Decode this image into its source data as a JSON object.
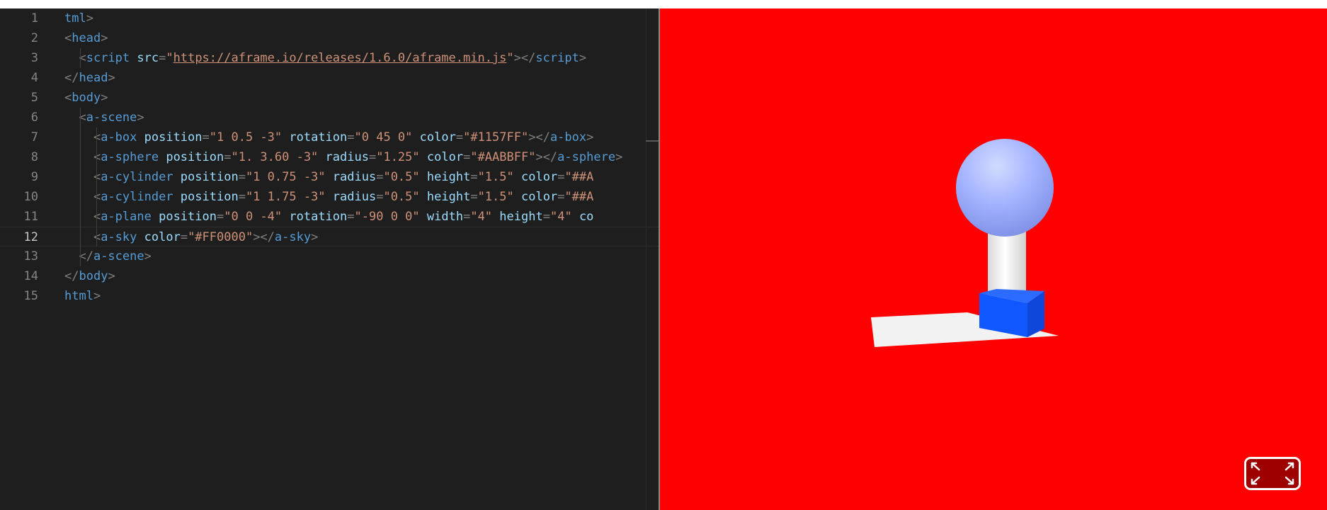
{
  "editor": {
    "lines": [
      {
        "num": "1",
        "tokens": [
          [
            "t",
            "tml"
          ],
          [
            "p",
            ">"
          ]
        ]
      },
      {
        "num": "2",
        "tokens": [
          [
            "p",
            "<"
          ],
          [
            "t",
            "head"
          ],
          [
            "p",
            ">"
          ]
        ]
      },
      {
        "num": "3",
        "tokens": [
          [
            "p",
            "  <"
          ],
          [
            "t",
            "script"
          ],
          [
            "p",
            " "
          ],
          [
            "a",
            "src"
          ],
          [
            "p",
            "="
          ],
          [
            "s",
            "\""
          ],
          [
            "su",
            "https://aframe.io/releases/1.6.0/aframe.min.js"
          ],
          [
            "s",
            "\""
          ],
          [
            "p",
            "></"
          ],
          [
            "t",
            "script"
          ],
          [
            "p",
            ">"
          ]
        ]
      },
      {
        "num": "4",
        "tokens": [
          [
            "p",
            "</"
          ],
          [
            "t",
            "head"
          ],
          [
            "p",
            ">"
          ]
        ]
      },
      {
        "num": "5",
        "tokens": [
          [
            "p",
            "<"
          ],
          [
            "t",
            "body"
          ],
          [
            "p",
            ">"
          ]
        ]
      },
      {
        "num": "6",
        "tokens": [
          [
            "p",
            "  <"
          ],
          [
            "t",
            "a-scene"
          ],
          [
            "p",
            ">"
          ]
        ]
      },
      {
        "num": "7",
        "tokens": [
          [
            "p",
            "    <"
          ],
          [
            "t",
            "a-box"
          ],
          [
            "p",
            " "
          ],
          [
            "a",
            "position"
          ],
          [
            "p",
            "="
          ],
          [
            "s",
            "\"1 0.5 -3\""
          ],
          [
            "p",
            " "
          ],
          [
            "a",
            "rotation"
          ],
          [
            "p",
            "="
          ],
          [
            "s",
            "\"0 45 0\""
          ],
          [
            "p",
            " "
          ],
          [
            "a",
            "color"
          ],
          [
            "p",
            "="
          ],
          [
            "s",
            "\"#1157FF\""
          ],
          [
            "p",
            "></"
          ],
          [
            "t",
            "a-box"
          ],
          [
            "p",
            ">"
          ]
        ]
      },
      {
        "num": "8",
        "tokens": [
          [
            "p",
            "    <"
          ],
          [
            "t",
            "a-sphere"
          ],
          [
            "p",
            " "
          ],
          [
            "a",
            "position"
          ],
          [
            "p",
            "="
          ],
          [
            "s",
            "\"1. 3.60 -3\""
          ],
          [
            "p",
            " "
          ],
          [
            "a",
            "radius"
          ],
          [
            "p",
            "="
          ],
          [
            "s",
            "\"1.25\""
          ],
          [
            "p",
            " "
          ],
          [
            "a",
            "color"
          ],
          [
            "p",
            "="
          ],
          [
            "s",
            "\"#AABBFF\""
          ],
          [
            "p",
            "></"
          ],
          [
            "t",
            "a-sphere"
          ],
          [
            "p",
            ">"
          ]
        ]
      },
      {
        "num": "9",
        "tokens": [
          [
            "p",
            "    <"
          ],
          [
            "t",
            "a-cylinder"
          ],
          [
            "p",
            " "
          ],
          [
            "a",
            "position"
          ],
          [
            "p",
            "="
          ],
          [
            "s",
            "\"1 0.75 -3\""
          ],
          [
            "p",
            " "
          ],
          [
            "a",
            "radius"
          ],
          [
            "p",
            "="
          ],
          [
            "s",
            "\"0.5\""
          ],
          [
            "p",
            " "
          ],
          [
            "a",
            "height"
          ],
          [
            "p",
            "="
          ],
          [
            "s",
            "\"1.5\""
          ],
          [
            "p",
            " "
          ],
          [
            "a",
            "color"
          ],
          [
            "p",
            "="
          ],
          [
            "s",
            "\"##A"
          ]
        ]
      },
      {
        "num": "10",
        "tokens": [
          [
            "p",
            "    <"
          ],
          [
            "t",
            "a-cylinder"
          ],
          [
            "p",
            " "
          ],
          [
            "a",
            "position"
          ],
          [
            "p",
            "="
          ],
          [
            "s",
            "\"1 1.75 -3\""
          ],
          [
            "p",
            " "
          ],
          [
            "a",
            "radius"
          ],
          [
            "p",
            "="
          ],
          [
            "s",
            "\"0.5\""
          ],
          [
            "p",
            " "
          ],
          [
            "a",
            "height"
          ],
          [
            "p",
            "="
          ],
          [
            "s",
            "\"1.5\""
          ],
          [
            "p",
            " "
          ],
          [
            "a",
            "color"
          ],
          [
            "p",
            "="
          ],
          [
            "s",
            "\"##A"
          ]
        ]
      },
      {
        "num": "11",
        "tokens": [
          [
            "p",
            "    <"
          ],
          [
            "t",
            "a-plane"
          ],
          [
            "p",
            " "
          ],
          [
            "a",
            "position"
          ],
          [
            "p",
            "="
          ],
          [
            "s",
            "\"0 0 -4\""
          ],
          [
            "p",
            " "
          ],
          [
            "a",
            "rotation"
          ],
          [
            "p",
            "="
          ],
          [
            "s",
            "\"-90 0 0\""
          ],
          [
            "p",
            " "
          ],
          [
            "a",
            "width"
          ],
          [
            "p",
            "="
          ],
          [
            "s",
            "\"4\""
          ],
          [
            "p",
            " "
          ],
          [
            "a",
            "height"
          ],
          [
            "p",
            "="
          ],
          [
            "s",
            "\"4\""
          ],
          [
            "p",
            " "
          ],
          [
            "a",
            "co"
          ]
        ]
      },
      {
        "num": "12",
        "current": true,
        "tokens": [
          [
            "p",
            "    <"
          ],
          [
            "t",
            "a-sky"
          ],
          [
            "p",
            " "
          ],
          [
            "a",
            "color"
          ],
          [
            "p",
            "="
          ],
          [
            "s",
            "\"#FF0000\""
          ],
          [
            "p",
            "></"
          ],
          [
            "t",
            "a-sky"
          ],
          [
            "p",
            ">"
          ]
        ]
      },
      {
        "num": "13",
        "tokens": [
          [
            "p",
            "  </"
          ],
          [
            "t",
            "a-scene"
          ],
          [
            "p",
            ">"
          ]
        ]
      },
      {
        "num": "14",
        "tokens": [
          [
            "p",
            "</"
          ],
          [
            "t",
            "body"
          ],
          [
            "p",
            ">"
          ]
        ]
      },
      {
        "num": "15",
        "tokens": [
          [
            "t",
            "html"
          ],
          [
            "p",
            ">"
          ]
        ]
      }
    ]
  },
  "preview": {
    "sky_color": "#FF0000",
    "box_color": "#1157FF",
    "sphere_color": "#AABBFF",
    "cylinder_color": "#FFFFFF",
    "plane_color": "#F2F2F2",
    "fullscreen_icon": "fullscreen-icon"
  }
}
